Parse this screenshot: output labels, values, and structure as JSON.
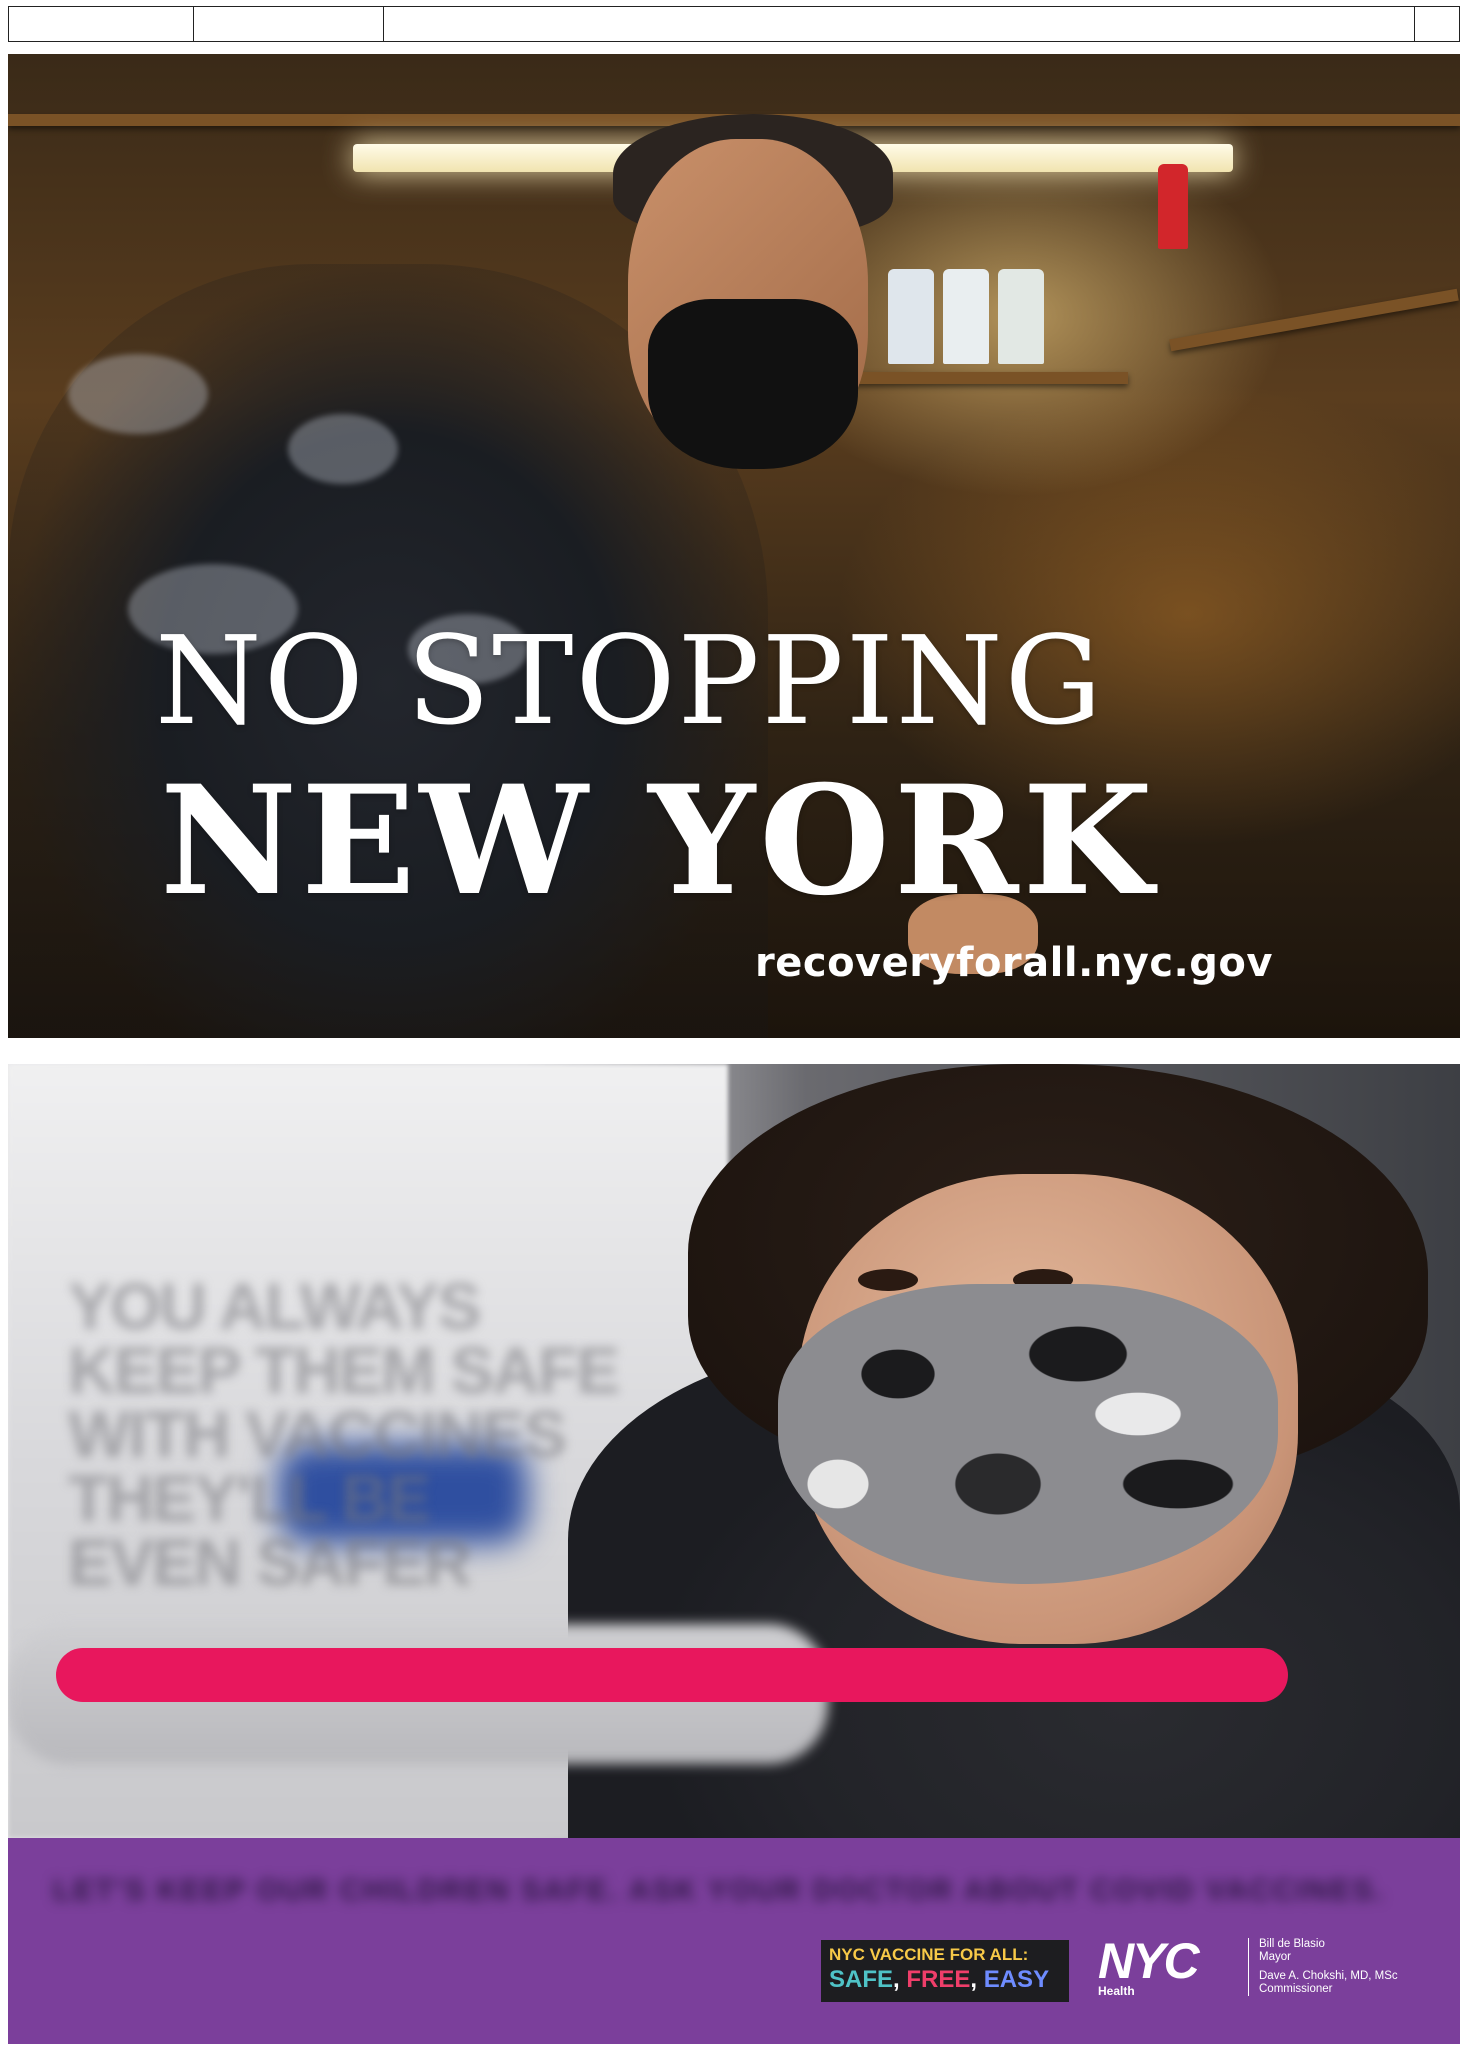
{
  "header": {
    "cells": [
      "",
      "",
      "",
      ""
    ]
  },
  "panel1": {
    "headline_top": "NO STOPPING",
    "headline_bottom": "NEW YORK",
    "url": "recoveryforall.nyc.gov"
  },
  "panel2": {
    "blurred_text": "YOU ALWAYS\nKEEP THEM SAFE\nWITH VACCINES\nTHEY'LL BE\nEVEN SAFER",
    "accent_bar_color": "#e8175d"
  },
  "footer": {
    "blurred_text": "LET'S KEEP OUR CHILDREN SAFE. ASK YOUR DOCTOR ABOUT COVID VACCINES.",
    "badge": {
      "line1": "NYC VACCINE FOR ALL:",
      "word_safe": "SAFE",
      "word_free": "FREE",
      "word_easy": "EASY",
      "comma": ", "
    },
    "logo": {
      "mark": "NYC",
      "sub": "Health"
    },
    "officials": {
      "mayor_name": "Bill de Blasio",
      "mayor_title": "Mayor",
      "commissioner_name": "Dave A. Chokshi, MD, MSc",
      "commissioner_title": "Commissioner"
    },
    "background_color": "#7b3f9b"
  }
}
